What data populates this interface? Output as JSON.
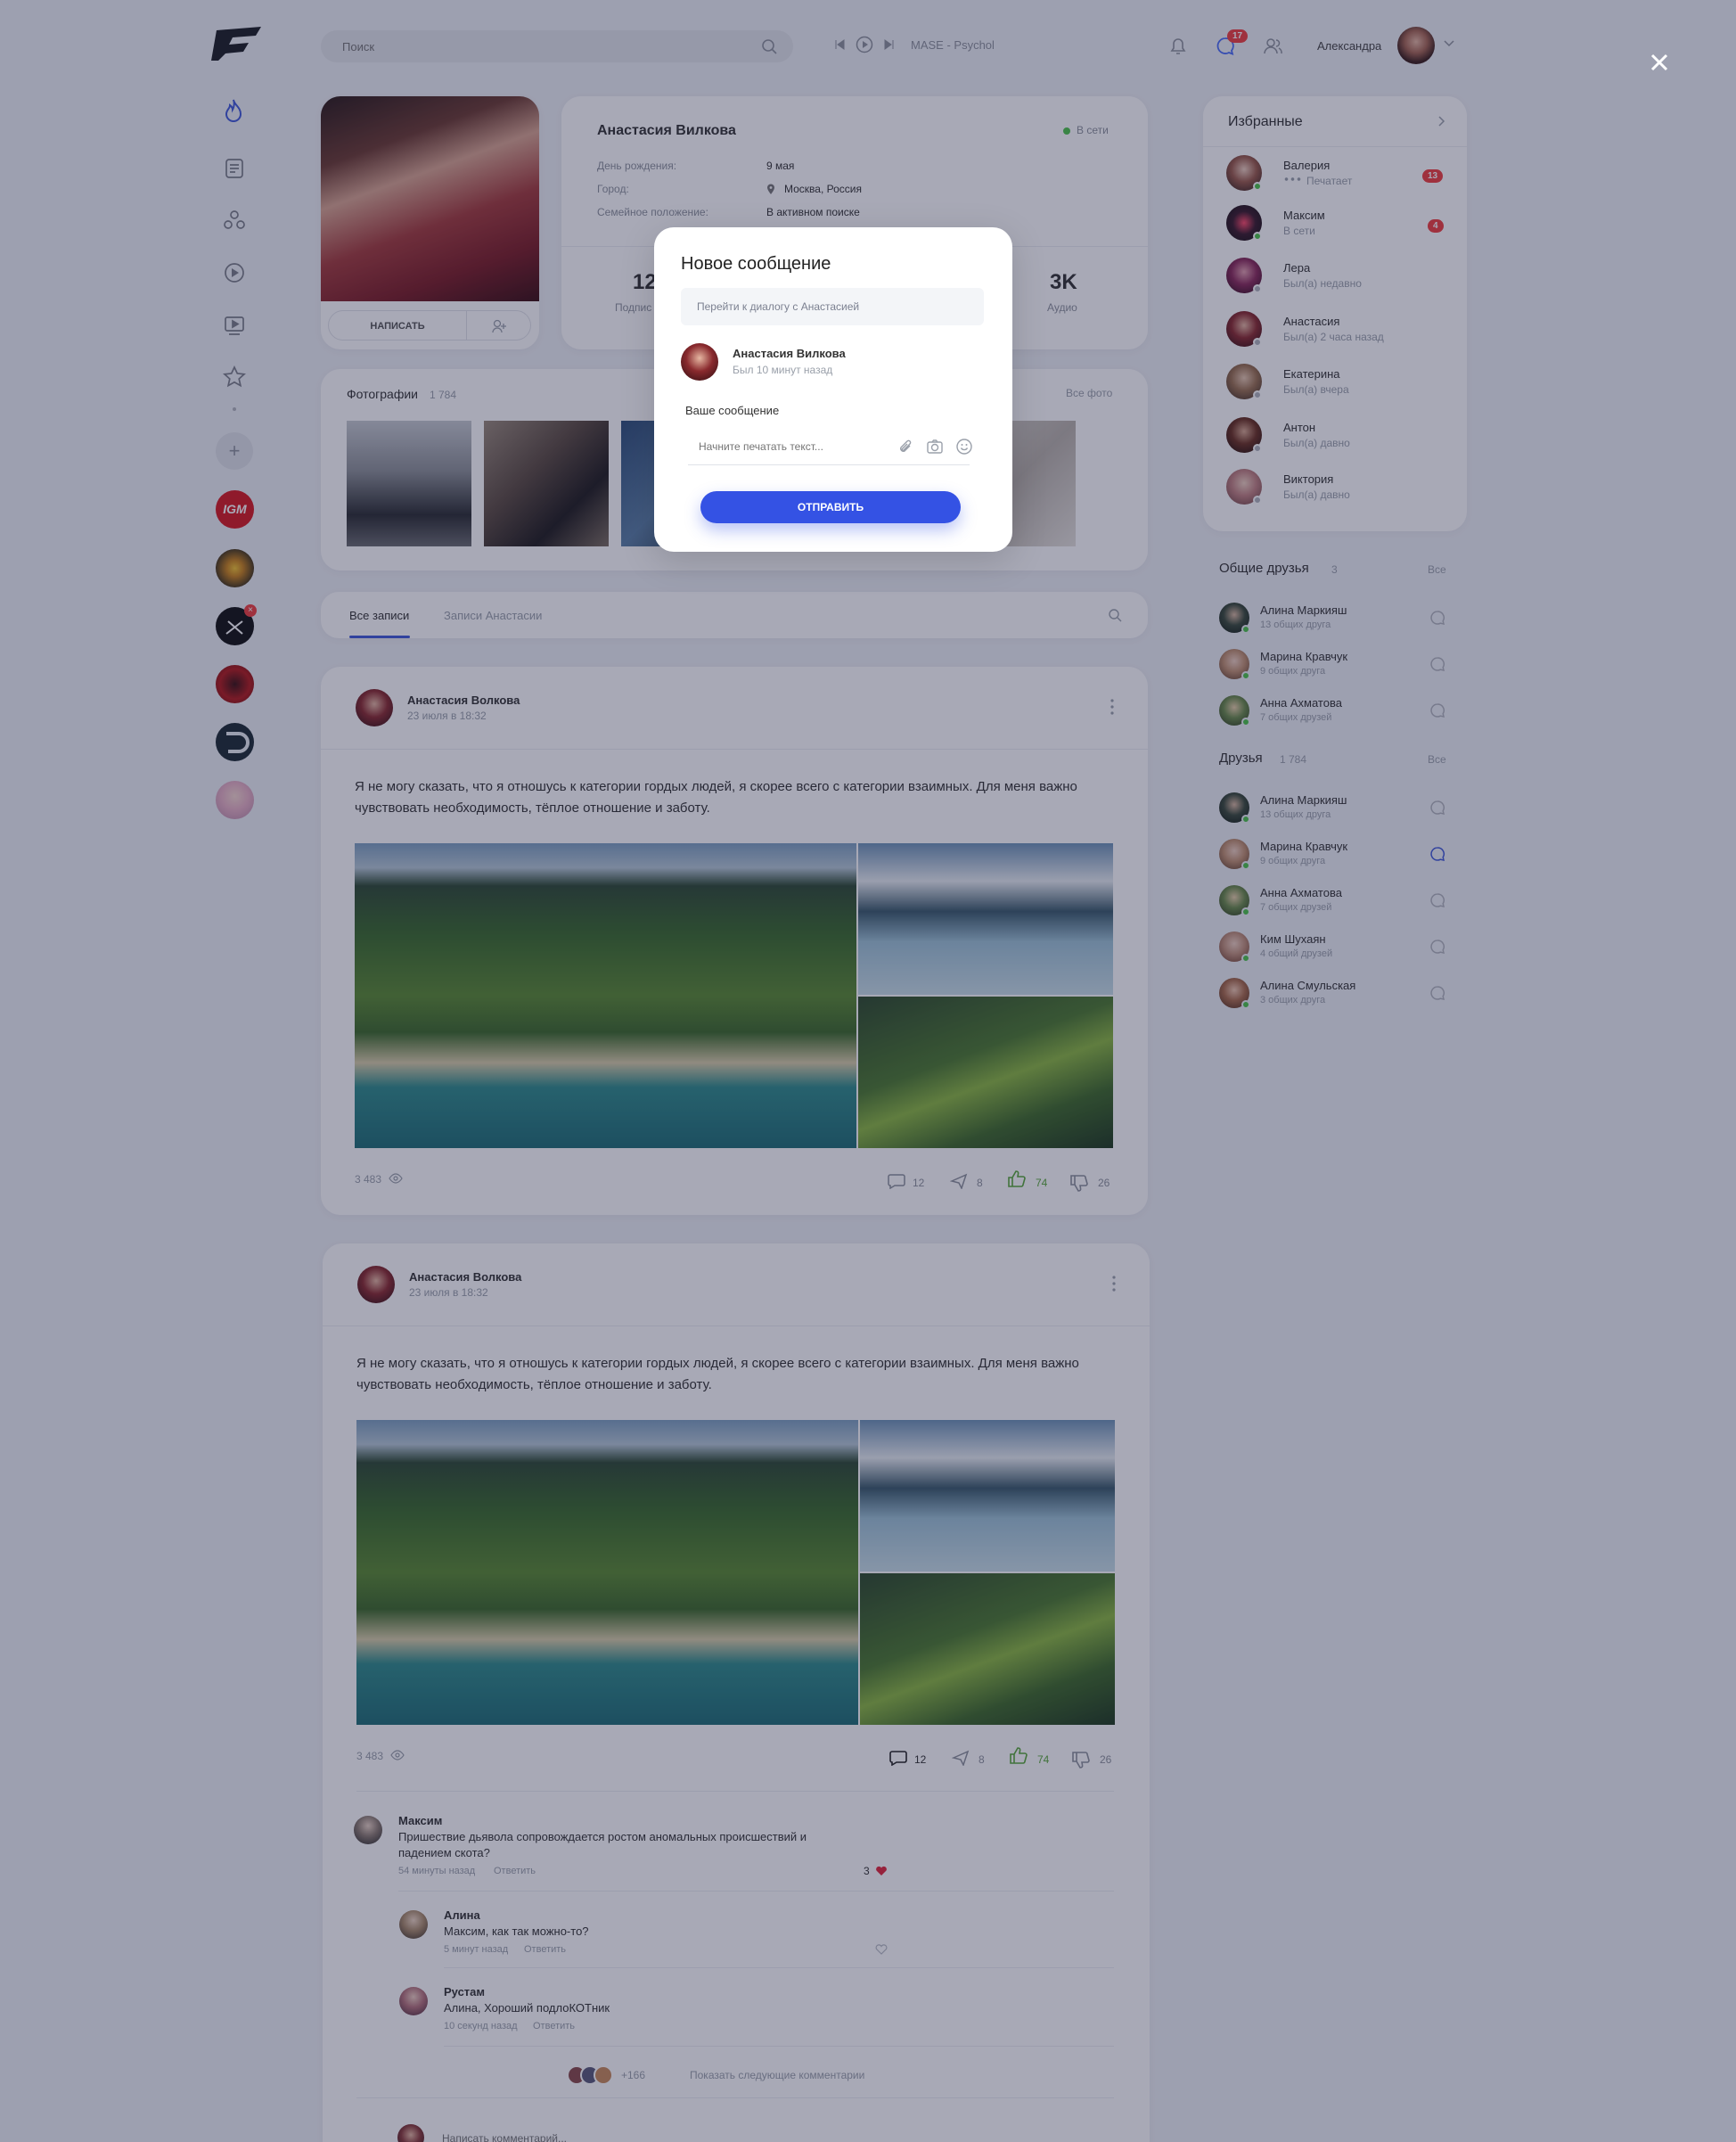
{
  "header": {
    "search_placeholder": "Поиск",
    "track": "MASE - Psychol",
    "notif_count": "17",
    "username": "Александра"
  },
  "sidebar": {
    "nav": [
      "flame-icon",
      "news-icon",
      "groups-icon",
      "video-icon",
      "media-icon",
      "star-icon"
    ],
    "add_label": "+",
    "groups": [
      {
        "label": "IGM",
        "color": "#d71920"
      },
      {
        "label": "",
        "color": "#5a4a1e"
      },
      {
        "label": "",
        "color": "#111"
      },
      {
        "label": "",
        "color": "#b31a1a"
      },
      {
        "label": "",
        "color": "#1c2a33"
      },
      {
        "label": "",
        "color": "#e7b0c4"
      }
    ],
    "badge": "×"
  },
  "profile": {
    "name": "Анастасия Вилкова",
    "status": "В сети",
    "fields": [
      {
        "label": "День рождения:",
        "value": "9 мая"
      },
      {
        "label": "Город:",
        "value": "Москва, Россия"
      },
      {
        "label": "Семейное положение:",
        "value": "В активном поиске"
      }
    ],
    "stats": [
      {
        "value": "12",
        "label": "Подпис"
      },
      {
        "value": "3K",
        "label": "Аудио"
      }
    ],
    "write_btn": "НАПИСАТЬ"
  },
  "photos": {
    "title": "Фотографии",
    "count": "1 784",
    "all": "Все фото"
  },
  "tabs": [
    "Все записи",
    "Записи Анастасии"
  ],
  "posts": [
    {
      "author": "Анастасия Волкова",
      "date": "23 июля в 18:32",
      "text1": "Я не могу сказать, что я отношусь к категории гордых людей, я скорее всего с категории взаимных. Для меня важно",
      "text2": "чувствовать необходимость, тёплое отношение и заботу.",
      "views": "3 483",
      "comments": "12",
      "reposts": "8",
      "likes": "74",
      "dislikes": "26"
    },
    {
      "author": "Анастасия Волкова",
      "date": "23 июля в 18:32",
      "text1": "Я не могу сказать, что я отношусь к категории гордых людей, я скорее всего с категории взаимных. Для меня важно",
      "text2": "чувствовать необходимость, тёплое отношение и заботу.",
      "views": "3 483",
      "comments": "12",
      "reposts": "8",
      "likes": "74",
      "dislikes": "26"
    }
  ],
  "comments": [
    {
      "name": "Максим",
      "line1": "Пришествие дьявола сопровождается ростом аномальных происшествий и",
      "line2": "падением скота?",
      "time": "54 минуты назад",
      "reply": "Ответить",
      "likes": "3"
    },
    {
      "name": "Алина",
      "line1": "Максим, как так можно-то?",
      "line2": "",
      "time": "5 минут назад",
      "reply": "Ответить",
      "likes": ""
    },
    {
      "name": "Рустам",
      "line1": "Алина, Хороший подлоКОТник",
      "line2": "",
      "time": "10 секунд назад",
      "reply": "Ответить",
      "likes": ""
    }
  ],
  "more_comments": {
    "count": "+166",
    "label": "Показать следующие комментарии"
  },
  "comment_placeholder": "Написать комментарий...",
  "favorites": {
    "title": "Избранные",
    "items": [
      {
        "name": "Валерия",
        "status": "Печатает",
        "badge": "13"
      },
      {
        "name": "Максим",
        "status": "В сети",
        "badge": "4"
      },
      {
        "name": "Лера",
        "status": "Был(а) недавно",
        "badge": ""
      },
      {
        "name": "Анастасия",
        "status": "Был(а) 2 часа назад",
        "badge": ""
      },
      {
        "name": "Екатерина",
        "status": "Был(а) вчера",
        "badge": ""
      },
      {
        "name": "Антон",
        "status": "Был(а) давно",
        "badge": ""
      },
      {
        "name": "Виктория",
        "status": "Был(а) давно",
        "badge": ""
      }
    ]
  },
  "mutual": {
    "title": "Общие друзья",
    "count": "3",
    "all": "Все",
    "items": [
      {
        "name": "Алина Маркияш",
        "sub": "13 общих друга"
      },
      {
        "name": "Марина Кравчук",
        "sub": "9 общих друга"
      },
      {
        "name": "Анна Ахматова",
        "sub": "7 общих друзей"
      }
    ]
  },
  "friends": {
    "title": "Друзья",
    "count": "1 784",
    "all": "Все",
    "items": [
      {
        "name": "Алина Маркияш",
        "sub": "13 общих друга"
      },
      {
        "name": "Марина Кравчук",
        "sub": "9 общих друга"
      },
      {
        "name": "Анна Ахматова",
        "sub": "7 общих друзей"
      },
      {
        "name": "Ким Шухаян",
        "sub": "4 общий друзей"
      },
      {
        "name": "Алина Смульская",
        "sub": "3 общих друга"
      }
    ]
  },
  "modal": {
    "title": "Новое сообщение",
    "goto": "Перейти к диалогу с Анастасией",
    "name": "Анастасия Вилкова",
    "seen": "Был 10 минут назад",
    "label": "Ваше сообщение",
    "placeholder": "Начните печатать текст...",
    "send": "ОТПРАВИТЬ"
  },
  "close": "✕"
}
